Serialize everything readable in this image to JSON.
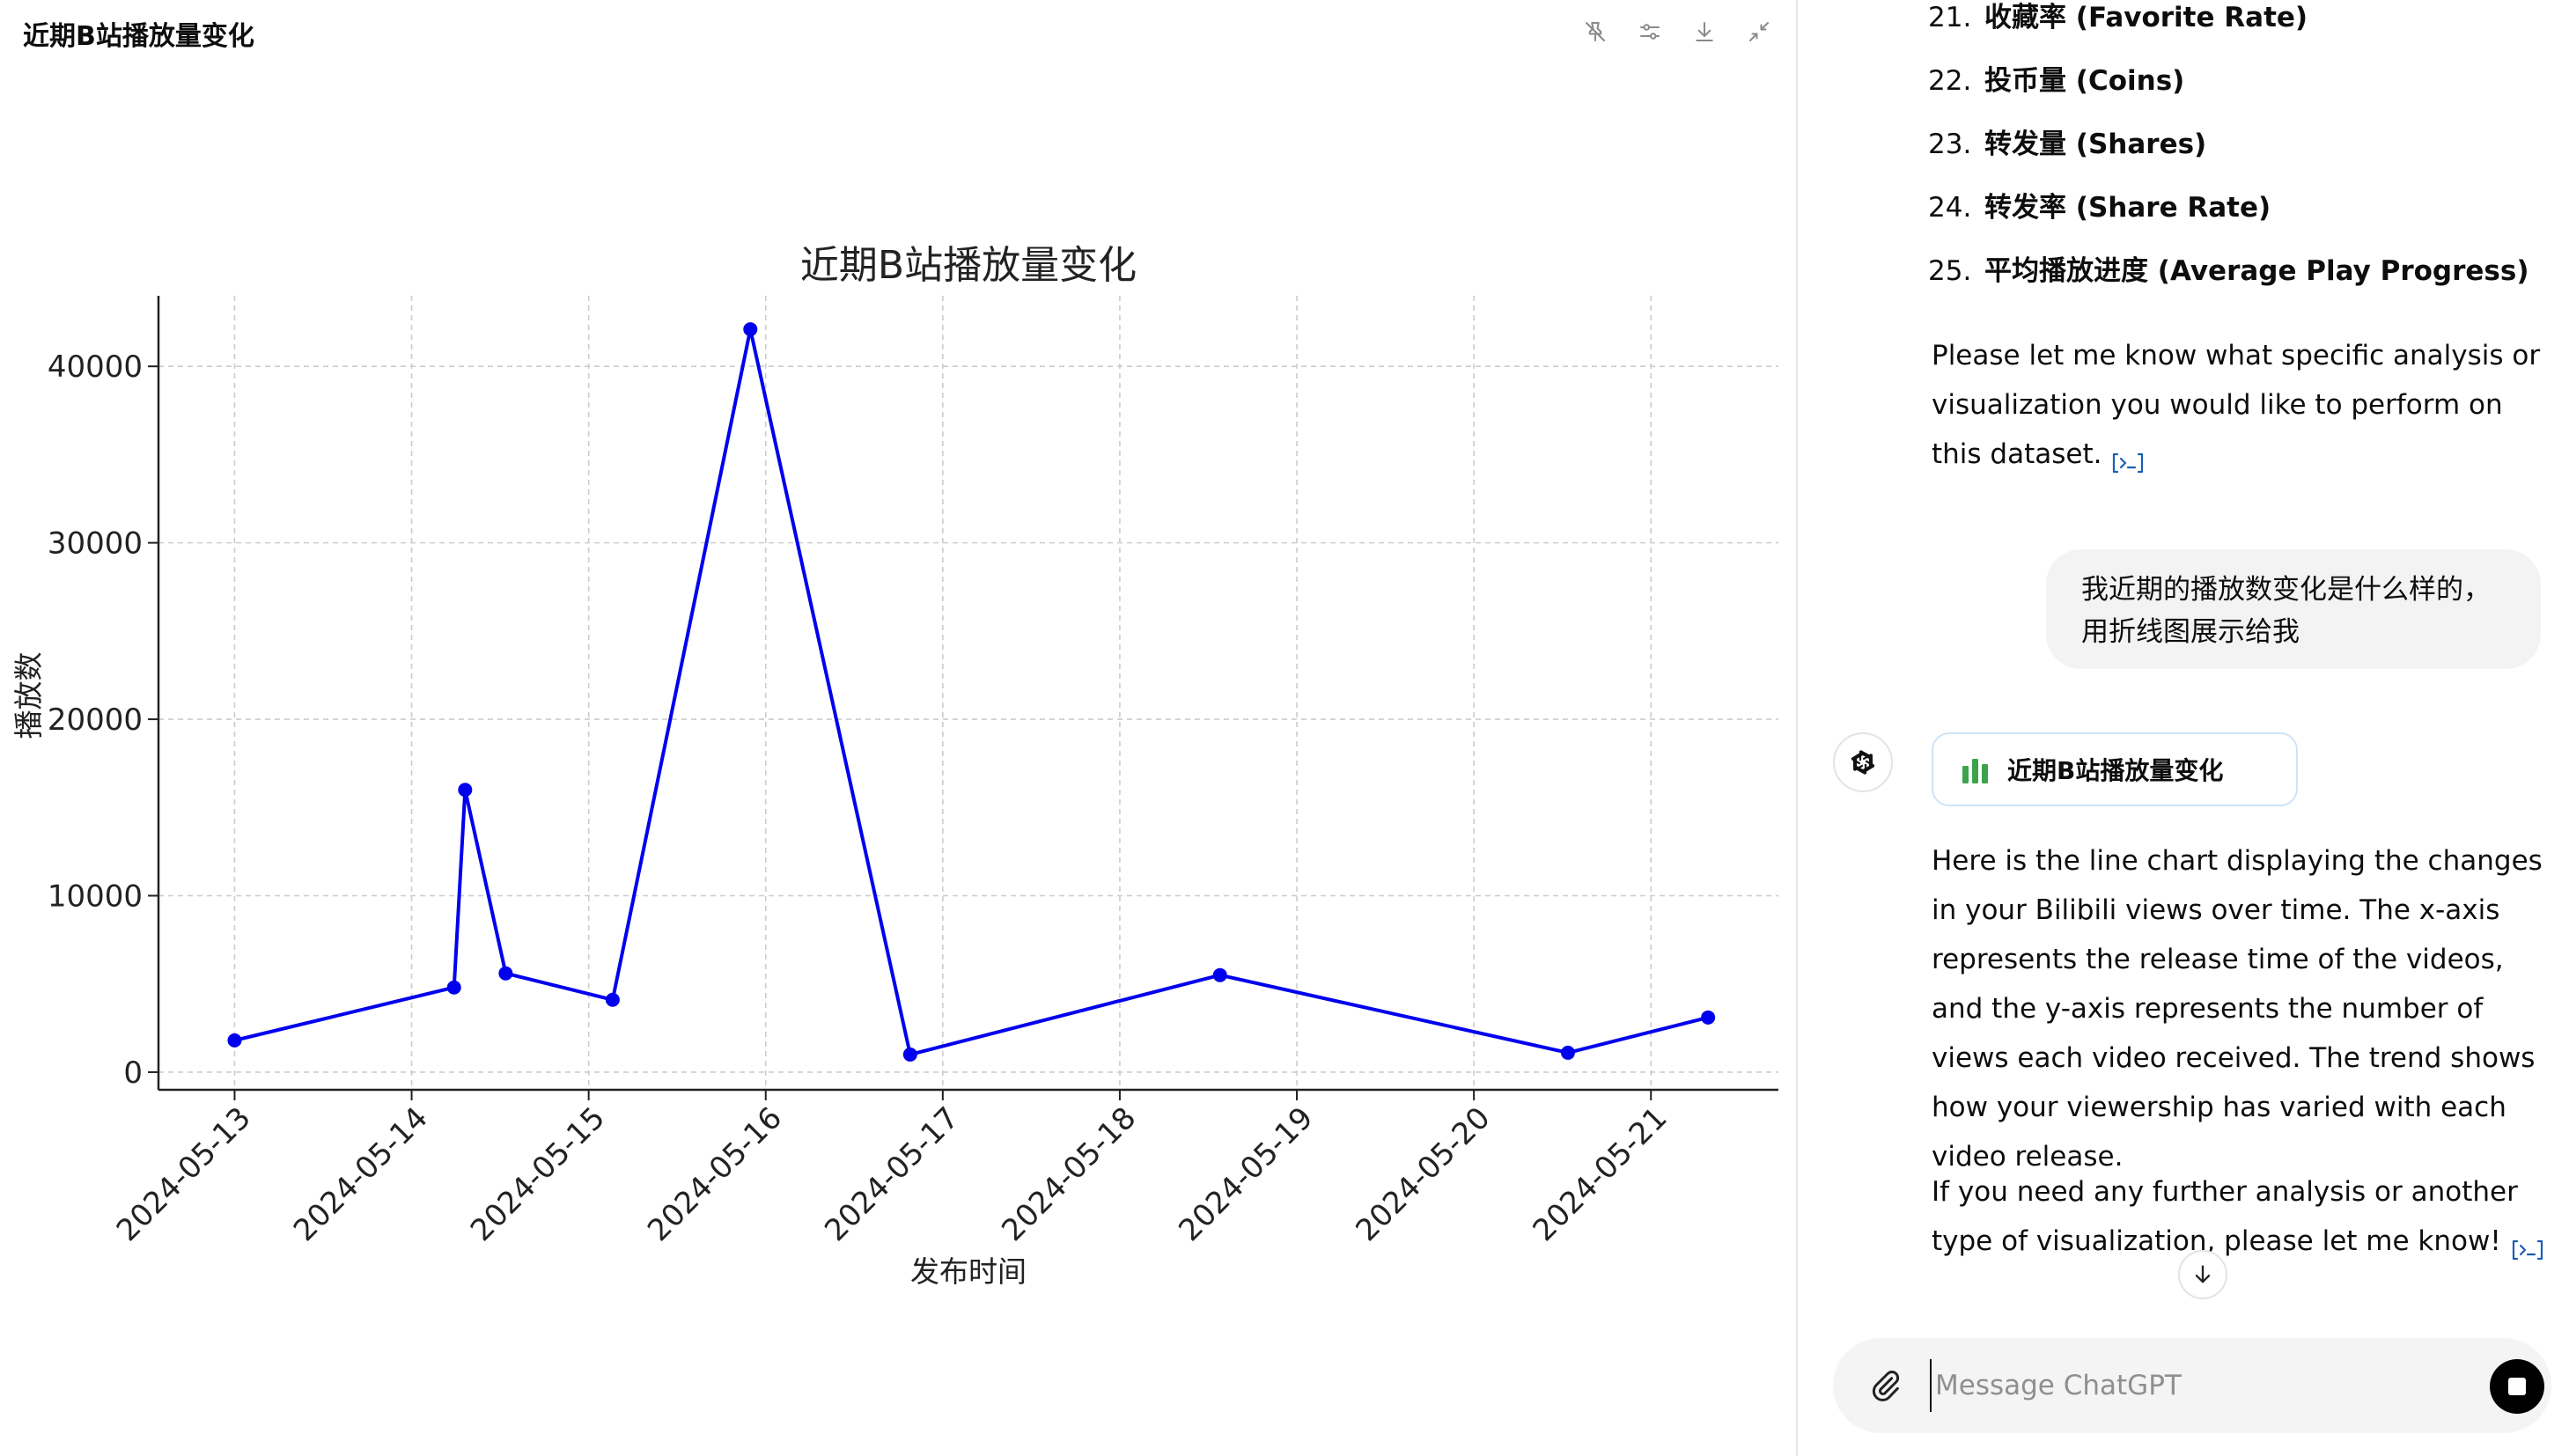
{
  "chart_panel": {
    "title": "近期B站播放量变化"
  },
  "chart_data": {
    "type": "line",
    "title": "近期B站播放量变化",
    "xlabel": "发布时间",
    "ylabel": "播放数",
    "x_ticks": [
      "2024-05-13",
      "2024-05-14",
      "2024-05-15",
      "2024-05-16",
      "2024-05-17",
      "2024-05-18",
      "2024-05-19",
      "2024-05-20",
      "2024-05-21"
    ],
    "y_ticks": [
      0,
      10000,
      20000,
      30000,
      40000
    ],
    "ylim": [
      -1000,
      44000
    ],
    "xlim_days": [
      -0.43,
      8.72
    ],
    "grid": true,
    "series": [
      {
        "color": "#0000ee",
        "points": [
          {
            "x": "2024-05-13 00:00",
            "y": 1800
          },
          {
            "x": "2024-05-14 05:45",
            "y": 4800
          },
          {
            "x": "2024-05-14 07:15",
            "y": 16000
          },
          {
            "x": "2024-05-14 12:45",
            "y": 5600
          },
          {
            "x": "2024-05-15 03:15",
            "y": 4100
          },
          {
            "x": "2024-05-15 21:55",
            "y": 42100
          },
          {
            "x": "2024-05-16 19:35",
            "y": 1000
          },
          {
            "x": "2024-05-18 13:35",
            "y": 5500
          },
          {
            "x": "2024-05-20 12:45",
            "y": 1100
          },
          {
            "x": "2024-05-21 07:45",
            "y": 3100
          }
        ]
      }
    ]
  },
  "chat": {
    "list_items": [
      {
        "num": "21.",
        "text": "收藏率 (Favorite Rate)"
      },
      {
        "num": "22.",
        "text": "投币量 (Coins)"
      },
      {
        "num": "23.",
        "text": "转发量 (Shares)"
      },
      {
        "num": "24.",
        "text": "转发率 (Share Rate)"
      },
      {
        "num": "25.",
        "text": "平均播放进度 (Average Play Progress)"
      }
    ],
    "para1": "Please let me know what specific analysis or visualization you would like to perform on this dataset.",
    "user_message": "我近期的播放数变化是什么样的，用折线图展示给我",
    "chart_card_label": "近期B站播放量变化",
    "para2": "Here is the line chart displaying the changes in your Bilibili views over time. The x-axis represents the release time of the videos, and the y-axis represents the number of views each video received. The trend shows how your viewership has varied with each video release.",
    "para3": "If you need any further analysis or another type of visualization, please let me know!",
    "input_placeholder": "Message ChatGPT"
  },
  "colors": {
    "series": "#0000ee",
    "grid": "#cccccc",
    "bubble": "#f3f3f3"
  }
}
